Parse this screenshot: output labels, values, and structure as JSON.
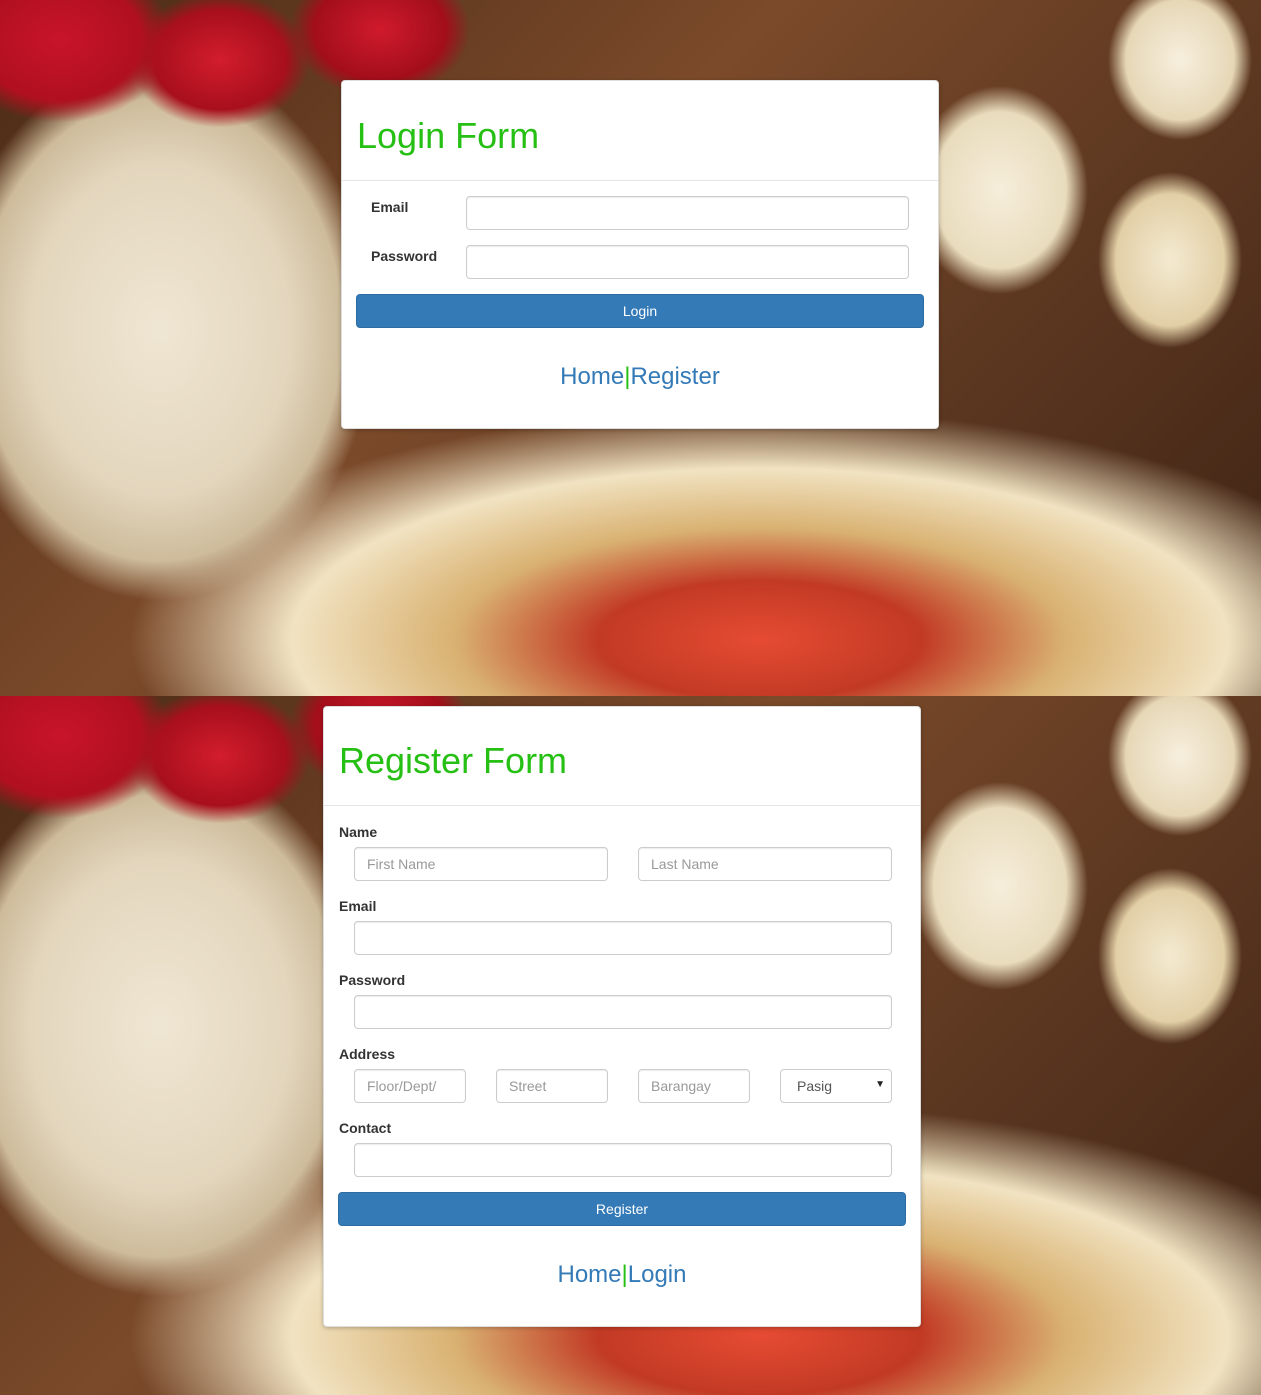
{
  "login": {
    "title": "Login Form",
    "email_label": "Email",
    "email_value": "",
    "password_label": "Password",
    "password_value": "",
    "submit_label": "Login",
    "links": {
      "home": "Home",
      "separator": "|",
      "register": "Register"
    }
  },
  "register": {
    "title": "Register Form",
    "name_label": "Name",
    "first_name_placeholder": "First Name",
    "last_name_placeholder": "Last Name",
    "email_label": "Email",
    "password_label": "Password",
    "address_label": "Address",
    "floor_placeholder": "Floor/Dept/",
    "street_placeholder": "Street",
    "barangay_placeholder": "Barangay",
    "city_selected": "Pasig",
    "contact_label": "Contact",
    "submit_label": "Register",
    "links": {
      "home": "Home",
      "separator": "|",
      "login": "Login"
    }
  },
  "icons": {
    "select_caret": "▼"
  },
  "colors": {
    "title": "#26c014",
    "primary": "#337ab7",
    "link": "#337ab7",
    "separator": "#26c014"
  }
}
